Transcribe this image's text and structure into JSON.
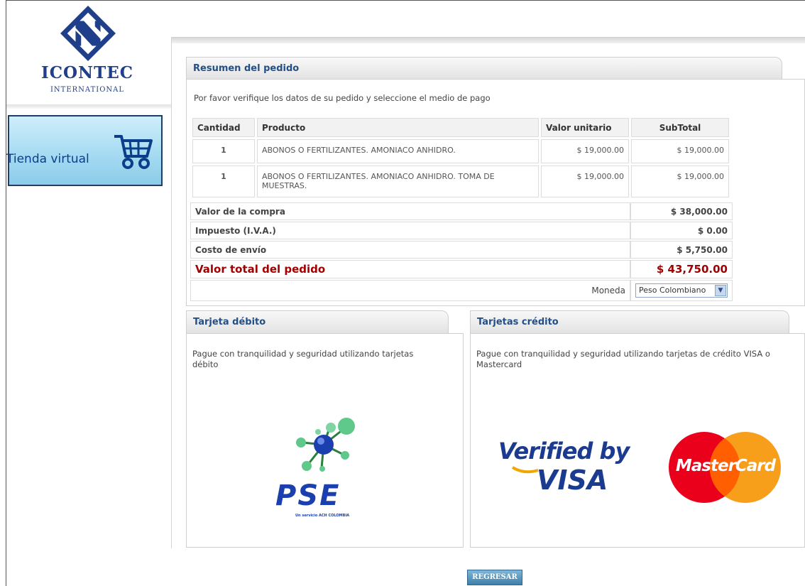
{
  "logo": {
    "name": "ICONTEC",
    "sub": "INTERNATIONAL"
  },
  "tienda": {
    "label": "Tienda virtual",
    "icon": "shopping-cart-icon"
  },
  "summary": {
    "title": "Resumen del pedido",
    "intro": "Por favor verifique los datos de su pedido y seleccione el medio de pago",
    "columns": [
      "Cantidad",
      "Producto",
      "Valor unitario",
      "SubTotal"
    ],
    "rows": [
      {
        "qty": "1",
        "product": "ABONOS O FERTILIZANTES. AMONIACO ANHIDRO.",
        "unit": "$ 19,000.00",
        "subtotal": "$ 19,000.00"
      },
      {
        "qty": "1",
        "product": "ABONOS O FERTILIZANTES. AMONIACO ANHIDRO. TOMA DE MUESTRAS.",
        "unit": "$ 19,000.00",
        "subtotal": "$ 19,000.00"
      }
    ],
    "totals": {
      "purchase_label": "Valor de la compra",
      "purchase_value": "$ 38,000.00",
      "tax_label": "Impuesto (I.V.A.)",
      "tax_value": "$ 0.00",
      "shipping_label": "Costo de envío",
      "shipping_value": "$ 5,750.00",
      "grand_label": "Valor total del pedido",
      "grand_value": "$ 43,750.00"
    },
    "currency_label": "Moneda",
    "currency_value": "Peso Colombiano"
  },
  "debit": {
    "title": "Tarjeta débito",
    "text": "Pague con tranquilidad y seguridad utilizando tarjetas débito",
    "logo": "PSE",
    "logo_small": "Un servicio ACH COLOMBIA"
  },
  "credit": {
    "title": "Tarjetas crédito",
    "text": "Pague con tranquilidad y seguridad utilizando tarjetas de crédito VISA o Mastercard",
    "visa_line1": "Verified by",
    "visa_line2": "VISA",
    "mastercard": "MasterCard"
  },
  "back_button": "REGRESAR",
  "colors": {
    "brand_blue": "#1f3f8a",
    "accent_red": "#a10000",
    "tab_title": "#244f86"
  }
}
